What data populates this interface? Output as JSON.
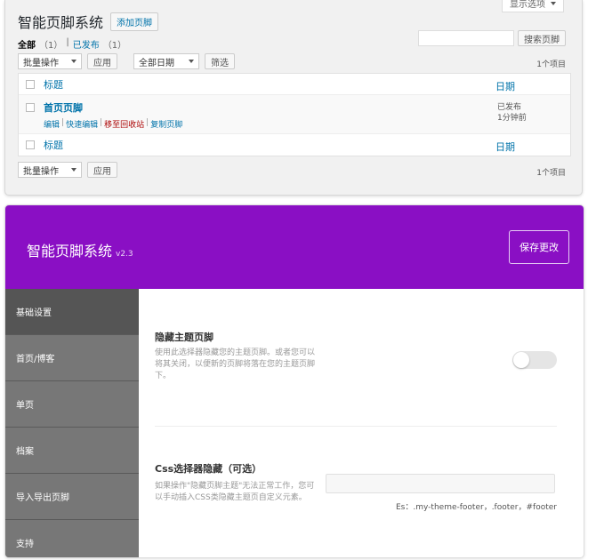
{
  "list_page": {
    "screen_options_label": "显示选项",
    "title": "智能页脚系统",
    "add_button": "添加页脚",
    "filters": {
      "all_label": "全部",
      "all_count": "（1）",
      "separator": "|",
      "published_label": "已发布",
      "published_count": "（1）"
    },
    "search_button": "搜索页脚",
    "bulk_action_label": "批量操作",
    "apply_button": "应用",
    "date_filter_label": "全部日期",
    "filter_button": "筛选",
    "items_count": "1个项目",
    "table": {
      "col_title": "标题",
      "col_date": "日期",
      "rows": [
        {
          "title": "首页页脚",
          "actions": [
            "编辑",
            "快速编辑",
            "移至回收站",
            "复制页脚"
          ],
          "status": "已发布",
          "time": "1分钟前"
        }
      ]
    }
  },
  "plugin": {
    "title": "智能页脚系统",
    "version": "v2.3",
    "save_button": "保存更改",
    "sidebar": [
      {
        "label": "基础设置",
        "active": true
      },
      {
        "label": "首页/博客",
        "active": false
      },
      {
        "label": "单页",
        "active": false
      },
      {
        "label": "档案",
        "active": false
      },
      {
        "label": "导入导出页脚",
        "active": false
      },
      {
        "label": "支持",
        "active": false
      }
    ],
    "settings": {
      "hide_footer": {
        "title": "隐藏主题页脚",
        "description": "使用此选择器隐藏您的主题页脚。或者您可以将其关闭，以便新的页脚将落在您的主题页脚下。",
        "enabled": false
      },
      "css_selector": {
        "title": "Css选择器隐藏（可选）",
        "description": "如果操作\"隐藏页脚主题\"无法正常工作，您可以手动插入CSS类隐藏主题页自定义元素。",
        "value": "",
        "hint": "Es：.my-theme-footer，.footer，#footer"
      }
    },
    "colors": {
      "header_bg": "#8a0fc4",
      "sidebar_bg": "#6d6d6d",
      "sidebar_active": "#555555"
    }
  }
}
